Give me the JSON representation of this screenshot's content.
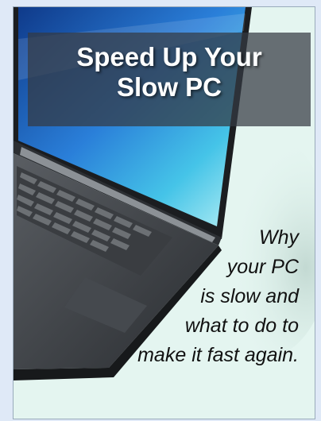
{
  "cover": {
    "title_line1": "Speed Up Your",
    "title_line2": "Slow PC",
    "tagline": [
      "Why",
      "your PC",
      "is slow and",
      "what to do to",
      "make it fast again."
    ]
  },
  "colors": {
    "page_background": "#dfe9f7",
    "cover_background": "#e4f5f0",
    "title_band": "#343a42",
    "title_text": "#ffffff",
    "tagline_text": "#111111",
    "screen_blue": "#2a7fd9"
  },
  "icons": [
    "laptop-illustration"
  ]
}
